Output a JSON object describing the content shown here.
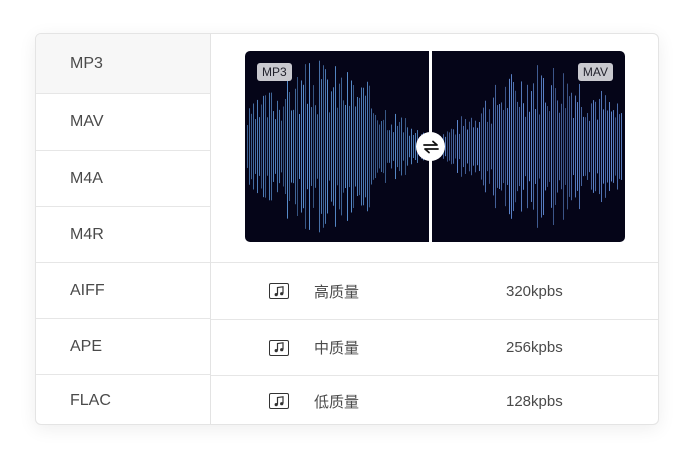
{
  "formats": [
    {
      "label": "MP3",
      "selected": true
    },
    {
      "label": "MAV",
      "selected": false
    },
    {
      "label": "M4A",
      "selected": false
    },
    {
      "label": "M4R",
      "selected": false
    },
    {
      "label": "AIFF",
      "selected": false
    },
    {
      "label": "APE",
      "selected": false
    },
    {
      "label": "FLAC",
      "selected": false
    }
  ],
  "preview": {
    "source_tag": "MP3",
    "target_tag": "MAV",
    "swap_icon": "swap-arrows-icon"
  },
  "quality": [
    {
      "icon": "music-note-icon",
      "label": "高质量",
      "bitrate": "320kpbs"
    },
    {
      "icon": "music-note-icon",
      "label": "中质量",
      "bitrate": "256kpbs"
    },
    {
      "icon": "music-note-icon",
      "label": "低质量",
      "bitrate": "128kpbs"
    }
  ],
  "colors": {
    "waveform_cyan": "#3fe0e8",
    "waveform_purple": "#8a52d6",
    "preview_background": "#050518"
  }
}
